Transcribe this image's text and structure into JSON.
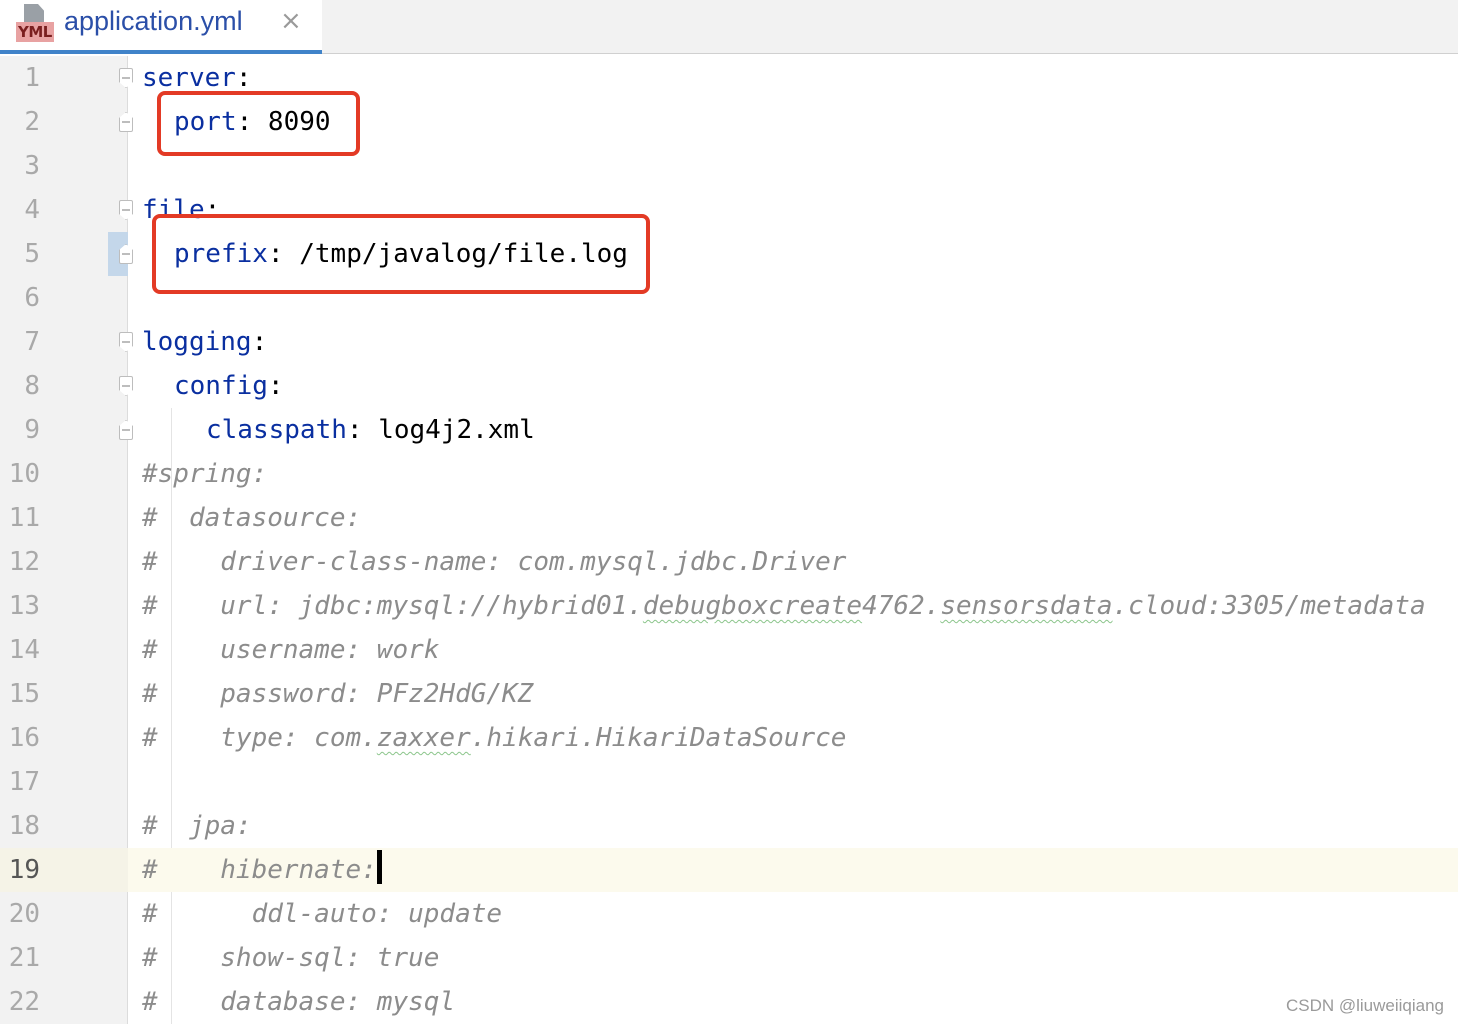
{
  "tab": {
    "title": "application.yml",
    "icon_badge": "YML",
    "close_glyph": "×"
  },
  "lines": [
    {
      "n": "1"
    },
    {
      "n": "2"
    },
    {
      "n": "3"
    },
    {
      "n": "4"
    },
    {
      "n": "5"
    },
    {
      "n": "6"
    },
    {
      "n": "7"
    },
    {
      "n": "8"
    },
    {
      "n": "9"
    },
    {
      "n": "10"
    },
    {
      "n": "11"
    },
    {
      "n": "12"
    },
    {
      "n": "13"
    },
    {
      "n": "14"
    },
    {
      "n": "15"
    },
    {
      "n": "16"
    },
    {
      "n": "17"
    },
    {
      "n": "18"
    },
    {
      "n": "19"
    },
    {
      "n": "20"
    },
    {
      "n": "21"
    },
    {
      "n": "22"
    }
  ],
  "code": {
    "l1_key": "server",
    "colon": ":",
    "l2_key": "port",
    "l2_val": " 8090",
    "l4_key": "file",
    "l5_key": "prefix",
    "l5_val": " /tmp/javalog/file.log",
    "l7_key": "logging",
    "l8_key": "config",
    "l9_key": "classpath",
    "l9_val": " log4j2.xml",
    "l10": "#spring:",
    "l11": "#  datasource:",
    "l12": "#    driver-class-name: com.mysql.jdbc.Driver",
    "l13_a": "#    url: jdbc:mysql://hybrid01.",
    "l13_b": "debugboxcreate",
    "l13_c": "4762.",
    "l13_d": "sensorsdata",
    "l13_e": ".cloud:3305/metadata",
    "l14": "#    username: work",
    "l15": "#    password: PFz2HdG/KZ",
    "l16_a": "#    type: com.",
    "l16_b": "zaxxer",
    "l16_c": ".hikari.HikariDataSource",
    "l18": "#  jpa:",
    "l19": "#    hibernate:",
    "l20": "#      ddl-auto: update",
    "l21": "#    show-sql: true",
    "l22": "#    database: mysql"
  },
  "current_line": "19",
  "highlight_color": "#e33a25",
  "key_color": "#0a2fa0",
  "comment_color": "#8c8c8c",
  "watermark": "CSDN @liuweiiqiang"
}
